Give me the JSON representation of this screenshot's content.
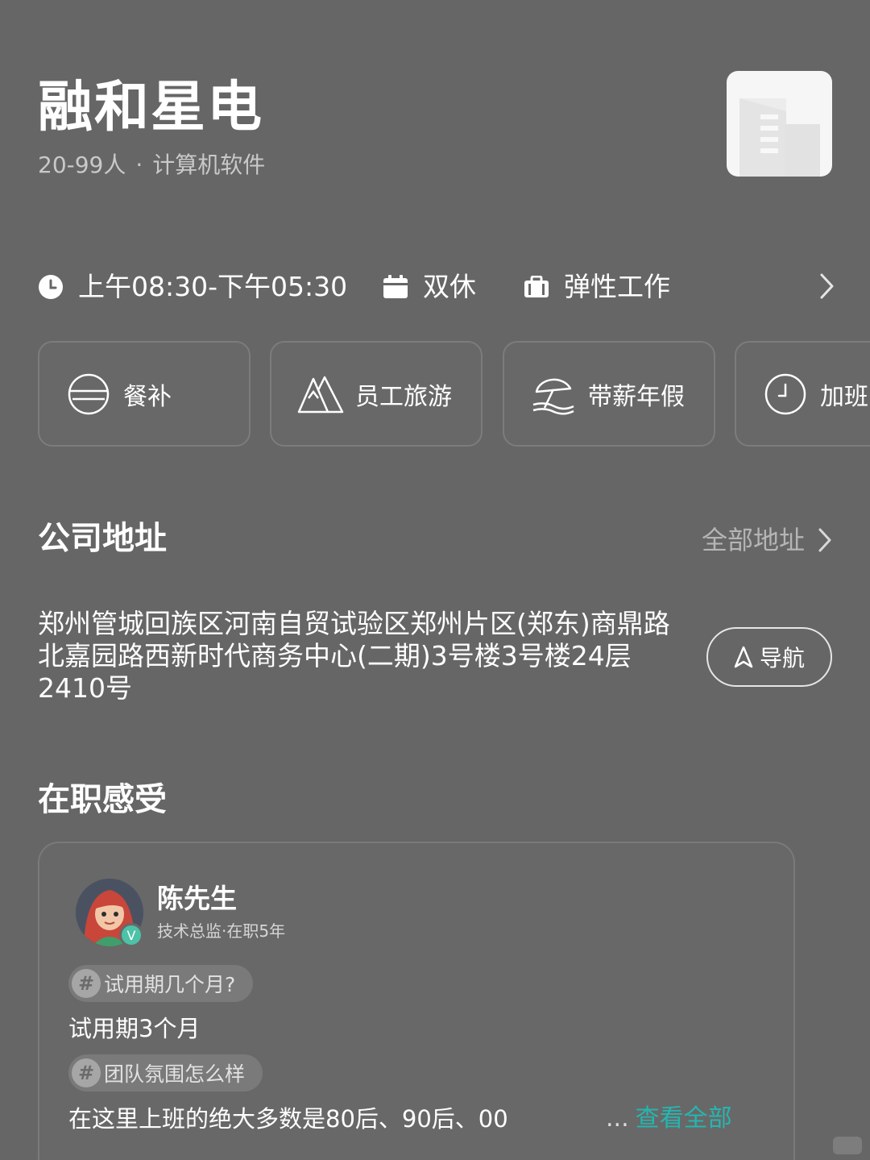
{
  "company": {
    "name": "融和星电",
    "size": "20-99人",
    "separator": "·",
    "industry": "计算机软件"
  },
  "work_info": {
    "hours": "上午08:30-下午05:30",
    "rest": "双休",
    "mode": "弹性工作"
  },
  "benefits": [
    {
      "label": "餐补",
      "icon": "bowl-icon"
    },
    {
      "label": "员工旅游",
      "icon": "mountain-icon"
    },
    {
      "label": "带薪年假",
      "icon": "beach-umbrella-icon"
    },
    {
      "label": "加班",
      "icon": "clock-icon"
    }
  ],
  "address_section": {
    "title": "公司地址",
    "all_link": "全部地址",
    "address": "郑州管城回族区河南自贸试验区郑州片区(郑东)商鼎路北嘉园路西新时代商务中心(二期)3号楼3号楼24层2410号",
    "nav_label": "导航"
  },
  "review_section": {
    "title": "在职感受",
    "reviewer_name": "陈先生",
    "reviewer_role": "技术总监·在职5年",
    "verified_mark": "V",
    "qa": [
      {
        "tag": "试用期几个月?",
        "answer": "试用期3个月"
      },
      {
        "tag": "团队氛围怎么样",
        "answer": "在这里上班的绝大多数是80后、90后、00"
      }
    ],
    "ellipsis": "...",
    "more_label": "查看全部",
    "hash": "#"
  },
  "colors": {
    "background": "#666666",
    "link_accent": "#25b6b0",
    "verified_badge": "#4cc2a6"
  }
}
